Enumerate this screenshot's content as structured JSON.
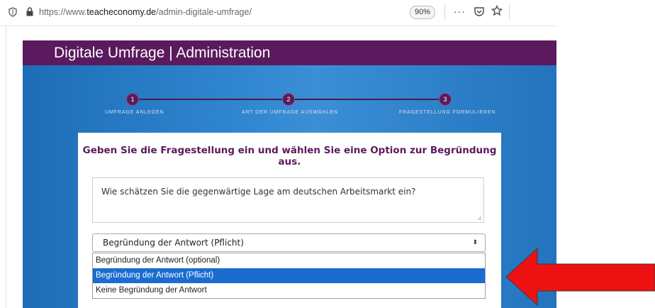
{
  "browser": {
    "url_prefix": "https://www.",
    "url_host": "teacheconomy.de",
    "url_path": "/admin-digitale-umfrage/",
    "zoom": "90%",
    "menu": "···"
  },
  "header": {
    "title": "Digitale Umfrage | Administration"
  },
  "steps": [
    {
      "number": "1",
      "label": "UMFRAGE ANLEGEN"
    },
    {
      "number": "2",
      "label": "ART DER UMFRAGE AUSWÄHLEN"
    },
    {
      "number": "3",
      "label": "FRAGESTELLUNG FORMULIEREN"
    }
  ],
  "form": {
    "heading": "Geben Sie die Fragestellung ein und wählen Sie eine Option zur Begründung aus.",
    "question": "Wie schätzen Sie die gegenwärtige Lage am deutschen Arbeitsmarkt ein?",
    "select_value": "Begründung der Antwort (Pflicht)",
    "select_arrow": "⬍",
    "options": [
      "Begründung der Antwort (optional)",
      "Begründung der Antwort (Pflicht)",
      "Keine Begründung der Antwort"
    ],
    "selected_option": "Begründung der Antwort (Pflicht)"
  },
  "colors": {
    "header_bg": "#5b1a5d",
    "highlight": "#1b6cd1",
    "arrow": "#ee1111"
  }
}
